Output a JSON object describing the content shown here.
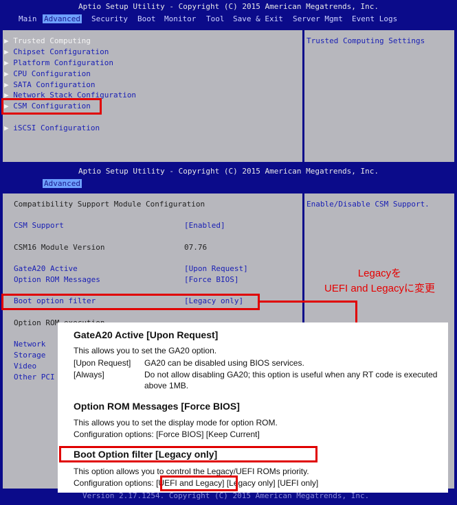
{
  "screen1": {
    "title": "Aptio Setup Utility - Copyright (C) 2015 American Megatrends, Inc.",
    "tabs": [
      "Main",
      "Advanced",
      "Security",
      "Boot",
      "Monitor",
      "Tool",
      "Save & Exit",
      "Server Mgmt",
      "Event Logs"
    ],
    "active_tab": "Advanced",
    "items": [
      "Trusted Computing",
      "Chipset Configuration",
      "Platform Configuration",
      "CPU Configuration",
      "SATA Configuration",
      "Network Stack Configuration",
      "CSM Configuration",
      "iSCSI Configuration"
    ],
    "help": "Trusted Computing Settings"
  },
  "screen2": {
    "title": "Aptio Setup Utility - Copyright (C) 2015 American Megatrends, Inc.",
    "tab": "Advanced",
    "heading": "Compatibility Support Module Configuration",
    "rows": [
      {
        "label": "CSM Support",
        "value": "[Enabled]"
      },
      {
        "label": "CSM16 Module Version",
        "value": "07.76"
      },
      {
        "label": "GateA20 Active",
        "value": "[Upon Request]"
      },
      {
        "label": "Option ROM Messages",
        "value": "[Force BIOS]"
      },
      {
        "label": "Boot option filter",
        "value": "[Legacy only]"
      },
      {
        "label": "Option ROM execution",
        "value": ""
      },
      {
        "label": "Network",
        "value": ""
      },
      {
        "label": "Storage",
        "value": ""
      },
      {
        "label": "Video",
        "value": ""
      },
      {
        "label": "Other PCI",
        "value": ""
      }
    ],
    "help": "Enable/Disable CSM Support.",
    "footer": "Version 2.17.1254. Copyright (C) 2015 American Megatrends, Inc."
  },
  "callout": {
    "line1": "Legacyを",
    "line2": "UEFI and Legacyに変更",
    "color": "#e50000"
  },
  "doc": {
    "h1": "GateA20 Active [Upon Request]",
    "p1": "This allows you to set the GA20 option.",
    "opt1_key": "[Upon Request]",
    "opt1_val": "GA20 can be disabled using BIOS services.",
    "opt2_key": "[Always]",
    "opt2_val": "Do not allow disabling GA20; this option is useful when any RT code is executed above 1MB.",
    "h2": "Option ROM Messages [Force BIOS]",
    "p2": "This allows you to set the display mode for option ROM.",
    "p3": "Configuration options: [Force BIOS] [Keep Current]",
    "h3": "Boot Option filter [Legacy only]",
    "p4": "This option allows you to control the Legacy/UEFI ROMs priority.",
    "p5_prefix": "Configuration options:",
    "p5_highlight": "[UEFI and Legacy]",
    "p5_suffix": "[Legacy only] [UEFI only]"
  }
}
